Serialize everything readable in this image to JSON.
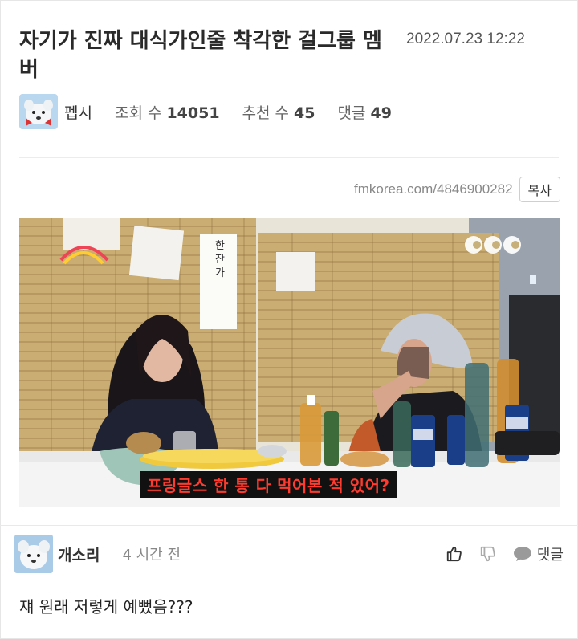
{
  "post": {
    "title": "자기가 진짜 대식가인줄 착각한 걸그룹 멤버",
    "date": "2022.07.23 12:22",
    "author": "펩시",
    "views_label": "조회 수",
    "views": "14051",
    "recommend_label": "추천 수",
    "recommend": "45",
    "comments_label": "댓글",
    "comments": "49",
    "url": "fmkorea.com/4846900282",
    "copy_label": "복사"
  },
  "video": {
    "subtitle": "프링글스 한 통 다 먹어본 적 있어?"
  },
  "comment": {
    "author": "개소리",
    "time": "4 시간 전",
    "reply_label": "댓글",
    "text": "쟤 원래 저렇게 예뻤음???"
  },
  "icons": [
    "thumbs-up-icon",
    "thumbs-down-icon",
    "speech-bubble-icon"
  ],
  "colors": {
    "subtitle_text": "#ff3b2f",
    "subtitle_bg": "#111111",
    "border": "#e6e6e6"
  }
}
